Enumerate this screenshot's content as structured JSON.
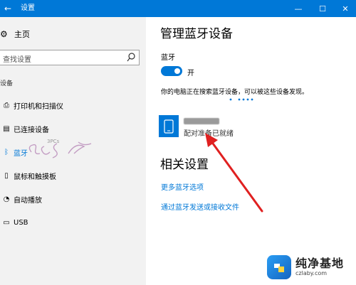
{
  "window": {
    "title": "设置",
    "back_glyph": "←",
    "minimize_glyph": "—",
    "maximize_glyph": "☐",
    "close_glyph": "✕",
    "accent_color": "#0078d7"
  },
  "sidebar": {
    "home_label": "主页",
    "search_placeholder": "查找设置",
    "group_label": "设备",
    "items": [
      {
        "label": "打印机和扫描仪",
        "icon": "printer-icon",
        "glyph": "⎙",
        "active": false
      },
      {
        "label": "已连接设备",
        "icon": "connected-devices-icon",
        "glyph": "▤",
        "active": false
      },
      {
        "label": "蓝牙",
        "icon": "bluetooth-icon",
        "glyph": "ᛒ",
        "active": true
      },
      {
        "label": "鼠标和触摸板",
        "icon": "mouse-icon",
        "glyph": "▯",
        "active": false
      },
      {
        "label": "自动播放",
        "icon": "autoplay-icon",
        "glyph": "◔",
        "active": false
      },
      {
        "label": "USB",
        "icon": "usb-icon",
        "glyph": "▭",
        "active": false
      }
    ]
  },
  "main": {
    "title": "管理蓝牙设备",
    "bluetooth_label": "蓝牙",
    "toggle_state": "开",
    "toggle_on": true,
    "searching_text": "你的电脑正在搜索蓝牙设备，可以被这些设备发现。",
    "device": {
      "name": "",
      "status": "配对准备已就绪",
      "icon": "phone-icon"
    },
    "related_title": "相关设置",
    "links": [
      "更多蓝牙选项",
      "通过蓝牙发送或接收文件"
    ]
  },
  "overlay": {
    "arrow_color": "#e02020"
  },
  "watermark": {
    "brand_name": "纯净基地",
    "brand_url": "czlaby.com",
    "sidebar_mark": "3PCs"
  }
}
